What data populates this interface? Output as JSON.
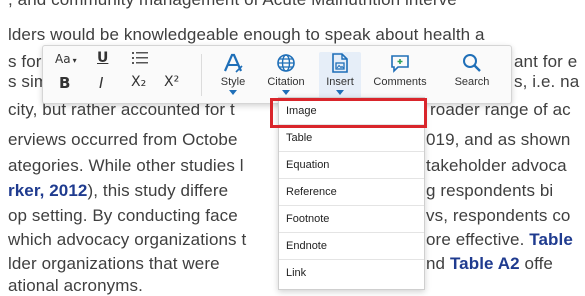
{
  "document": {
    "lines": [
      ", and community management of Acute Malnutrition interve",
      "lders would be knowledgeable enough to speak about health a",
      "s for",
      "s sim",
      "city, but rather accounted for t",
      "erviews occurred from Octobe",
      "ategories. While other studies l",
      "rker, 2012",
      "), this study differe",
      "op setting. By conducting face",
      "which advocacy organizations t",
      "lder organizations that were",
      "ational acronyms."
    ],
    "right_fragments": [
      "ant for e",
      "s, i.e. na",
      "roader range of ac",
      "019, and as shown",
      "takeholder advoca",
      "g respondents bi",
      "vs, respondents co",
      "ore effective.",
      "Table",
      "nd",
      "Table A2",
      "offe"
    ]
  },
  "toolbar": {
    "font_size_label": "Aa",
    "underline_label": "U",
    "list_label": "☰",
    "bold_label": "B",
    "italic_label": "I",
    "subscript_label": "X₂",
    "superscript_label": "X²",
    "style_label": "Style",
    "citation_label": "Citation",
    "insert_label": "Insert",
    "comments_label": "Comments",
    "search_label": "Search"
  },
  "insert_menu": {
    "items": [
      "Image",
      "Table",
      "Equation",
      "Reference",
      "Footnote",
      "Endnote",
      "Link"
    ],
    "highlighted": "Image"
  },
  "colors": {
    "accent": "#1f6fb8",
    "highlight_box": "#d9252b",
    "link_text": "#1f3b8f"
  }
}
